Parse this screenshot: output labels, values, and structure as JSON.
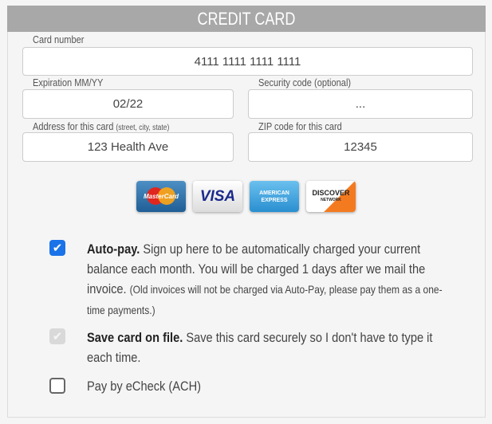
{
  "header": {
    "title": "CREDIT CARD"
  },
  "fields": {
    "card_number": {
      "label": "Card number",
      "value": "4111 1111 1111 1111"
    },
    "expiration": {
      "label": "Expiration MM/YY",
      "value": "02/22"
    },
    "security": {
      "label": "Security code (optional)",
      "value": "..."
    },
    "address": {
      "label": "Address for this card",
      "hint": "(street, city, state)",
      "value": "123 Health Ave"
    },
    "zip": {
      "label": "ZIP code for this card",
      "value": "12345"
    }
  },
  "cards": {
    "mastercard": "MasterCard",
    "visa": "VISA",
    "amex1": "AMERICAN",
    "amex2": "EXPRESS",
    "discover": "DISCOVER",
    "discover_sub": "NETWORK"
  },
  "options": {
    "autopay": {
      "checked": true,
      "title": "Auto-pay.",
      "text": " Sign up here to be automatically charged your current balance each month. You will be charged 1 days after we mail the invoice. ",
      "note": "(Old invoices will not be charged via Auto-Pay, please pay them as a one-time payments.)"
    },
    "save_card": {
      "checked": true,
      "disabled": true,
      "title": "Save card on file.",
      "text": " Save this card securely so I don't have to type it each time."
    },
    "echeck": {
      "checked": false,
      "title": "Pay by eCheck (ACH)"
    }
  },
  "colors": {
    "header": "#a8a8a8",
    "checkbox": "#1a73e8"
  }
}
